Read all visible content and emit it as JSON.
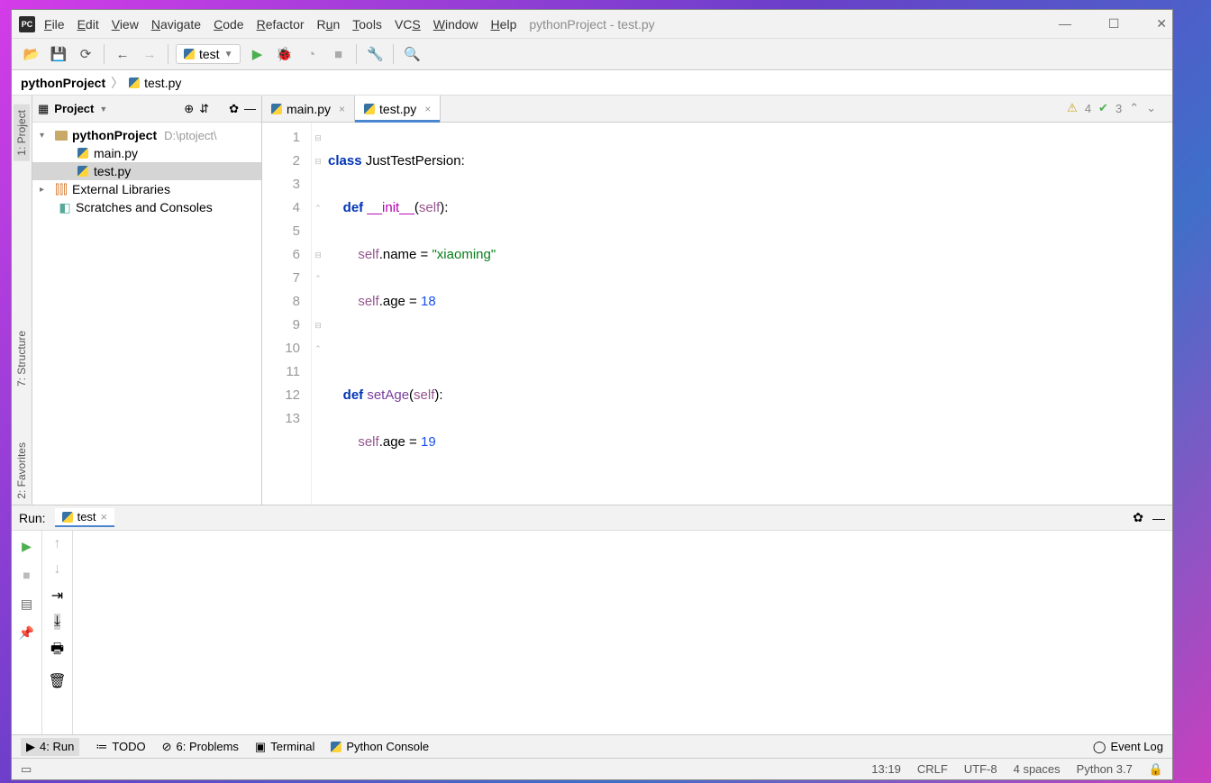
{
  "title": "pythonProject - test.py",
  "menu": [
    "File",
    "Edit",
    "View",
    "Navigate",
    "Code",
    "Refactor",
    "Run",
    "Tools",
    "VCS",
    "Window",
    "Help"
  ],
  "toolbar": {
    "run_config": "test"
  },
  "breadcrumb": {
    "root": "pythonProject",
    "file": "test.py"
  },
  "left_tabs": {
    "project": "1: Project",
    "structure": "7: Structure",
    "favorites": "2: Favorites"
  },
  "project_panel": {
    "title": "Project",
    "root": "pythonProject",
    "root_path": "D:\\ptoject\\",
    "files": [
      "main.py",
      "test.py"
    ],
    "external": "External Libraries",
    "scratches": "Scratches and Consoles"
  },
  "tabs": [
    {
      "name": "main.py"
    },
    {
      "name": "test.py"
    }
  ],
  "inspection": {
    "warn": "4",
    "ok": "3"
  },
  "code": {
    "lines": [
      "1",
      "2",
      "3",
      "4",
      "5",
      "6",
      "7",
      "8",
      "9",
      "10",
      "11",
      "12",
      "13"
    ]
  },
  "run_panel": {
    "label": "Run:",
    "tab": "test"
  },
  "bottom_bar": {
    "run": "4: Run",
    "todo": "TODO",
    "problems": "6: Problems",
    "terminal": "Terminal",
    "pyconsole": "Python Console",
    "eventlog": "Event Log"
  },
  "status": {
    "pos": "13:19",
    "le": "CRLF",
    "enc": "UTF-8",
    "indent": "4 spaces",
    "py": "Python 3.7"
  }
}
